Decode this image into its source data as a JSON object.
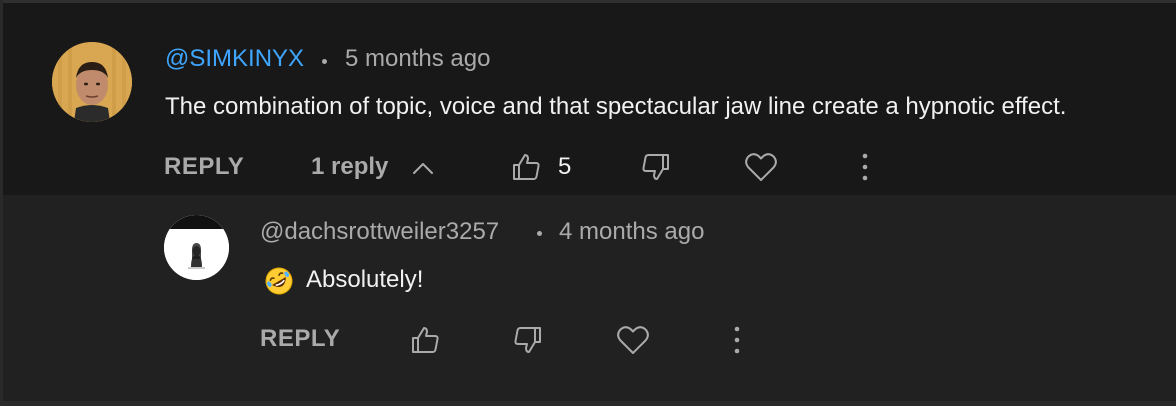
{
  "comment": {
    "author": "@SIMKINYX",
    "time": "5 months ago",
    "text": "The combination of topic, voice and that spectacular jaw line create a hypnotic effect.",
    "reply_label": "REPLY",
    "replies_toggle_label": "1 reply",
    "like_count": "5"
  },
  "reply": {
    "author": "@dachsrottweiler3257",
    "time": "4 months ago",
    "text": "Absolutely!",
    "emoji_icon": "rolling-on-floor-laughing-emoji",
    "reply_label": "REPLY"
  },
  "icons": [
    "thumbs-up-icon",
    "thumbs-down-icon",
    "heart-icon",
    "more-vert-icon",
    "chevron-up-icon"
  ],
  "colors": {
    "background": "#212121",
    "comment_background": "#181818",
    "author_link": "#3ea6ff",
    "secondary_text": "#aaaaaa",
    "primary_text": "#f1f1f1"
  }
}
